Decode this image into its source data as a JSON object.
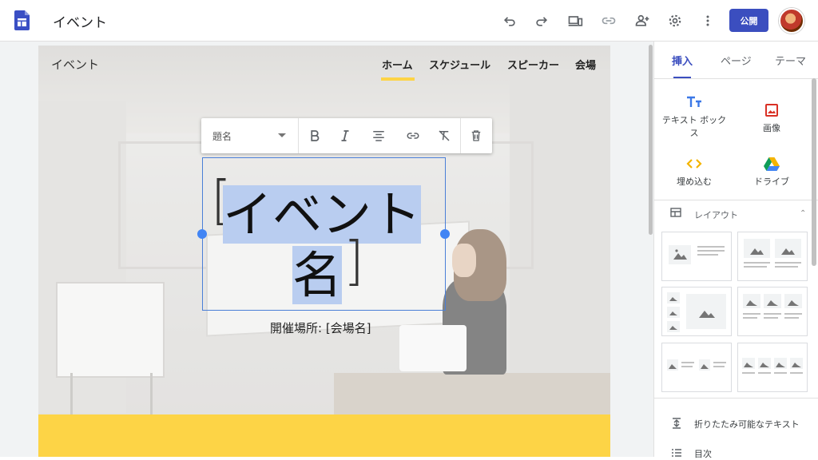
{
  "app": {
    "title": "イベント",
    "logo_icon": "google-sites-logo",
    "accent": "#3b4ebf"
  },
  "topbar": {
    "icons": [
      "undo-icon",
      "redo-icon",
      "preview-devices-icon",
      "link-icon",
      "share-person-add-icon",
      "settings-gear-icon",
      "more-vert-icon"
    ],
    "publish_label": "公開"
  },
  "site": {
    "name": "イベント",
    "nav": [
      "ホーム",
      "スケジュール",
      "スピーカー",
      "会場"
    ],
    "active_nav": "ホーム"
  },
  "format_toolbar": {
    "style_value": "題名",
    "buttons": [
      "bold-icon",
      "italic-icon",
      "align-center-icon",
      "link-icon",
      "clear-format-icon",
      "delete-icon"
    ]
  },
  "hero": {
    "title_open": "[",
    "title_line1": "イベント",
    "title_line2": "名",
    "title_close": "]",
    "venue": "開催場所: [会場名]",
    "band_color": "#fdd446"
  },
  "panel": {
    "tabs": [
      "挿入",
      "ページ",
      "テーマ"
    ],
    "active_tab": "挿入",
    "insert_items": [
      {
        "label": "テキスト ボックス",
        "icon": "text-box-icon"
      },
      {
        "label": "画像",
        "icon": "image-icon"
      },
      {
        "label": "埋め込む",
        "icon": "embed-code-icon"
      },
      {
        "label": "ドライブ",
        "icon": "drive-icon"
      }
    ],
    "layout_label": "レイアウト",
    "extra_items": [
      {
        "label": "折りたたみ可能なテキスト",
        "icon": "collapsible-text-icon"
      },
      {
        "label": "目次",
        "icon": "table-of-contents-icon"
      }
    ]
  }
}
